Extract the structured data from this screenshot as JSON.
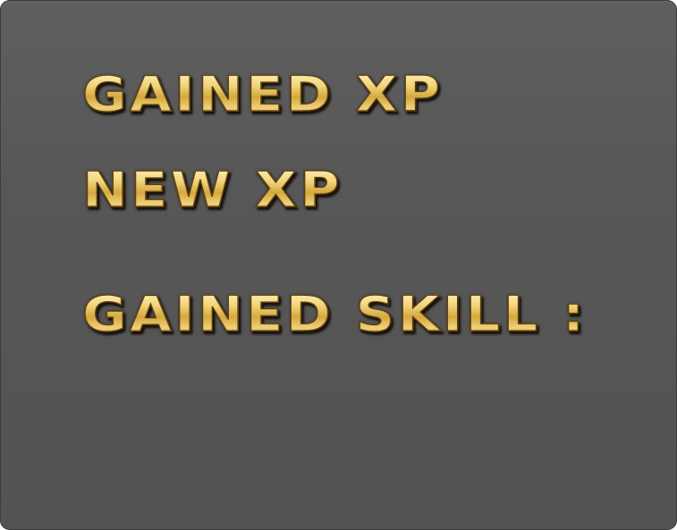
{
  "results_panel": {
    "gained_xp_label": "GAINED XP",
    "new_xp_label": "NEW XP",
    "gained_skill_label": "GAINED SKILL :",
    "colors": {
      "panel_background": "#575757",
      "text_gold": "#e7c562",
      "text_outline": "#5b3d0f"
    }
  }
}
